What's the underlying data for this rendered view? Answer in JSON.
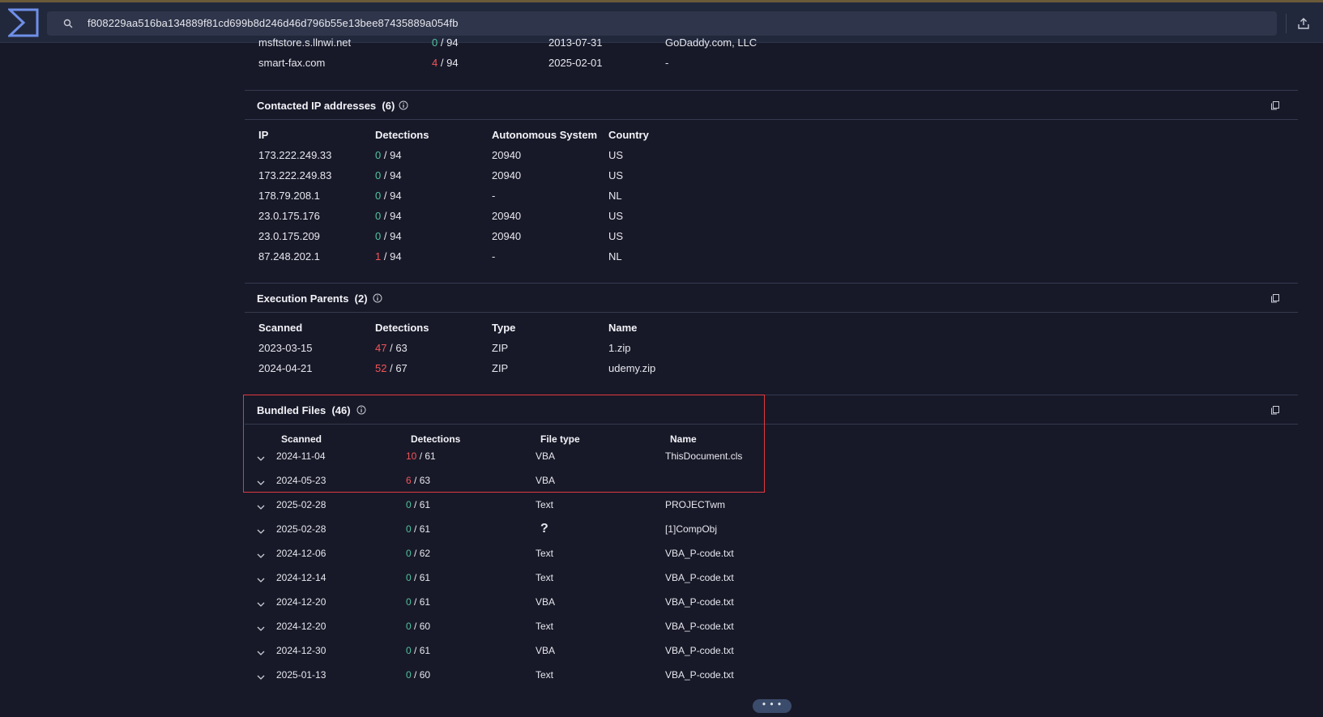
{
  "search": {
    "value": "f808229aa516ba134889f81cd699b8d246d46d796b55e13bee87435889a054fb"
  },
  "domains_partial": {
    "rows": [
      {
        "domain": "msftstore.s.llnwi.net",
        "det": "0",
        "total": "/ 94",
        "date": "2013-07-31",
        "registrar": "GoDaddy.com, LLC"
      },
      {
        "domain": "smart-fax.com",
        "det": "4",
        "total": "/ 94",
        "date": "2025-02-01",
        "registrar": "-"
      }
    ]
  },
  "contacted_ips": {
    "title": "Contacted IP addresses",
    "count": "(6)",
    "headers": [
      "IP",
      "Detections",
      "Autonomous System",
      "Country"
    ],
    "rows": [
      {
        "ip": "173.222.249.33",
        "det": "0",
        "total": "/ 94",
        "as": "20940",
        "country": "US"
      },
      {
        "ip": "173.222.249.83",
        "det": "0",
        "total": "/ 94",
        "as": "20940",
        "country": "US"
      },
      {
        "ip": "178.79.208.1",
        "det": "0",
        "total": "/ 94",
        "as": "-",
        "country": "NL"
      },
      {
        "ip": "23.0.175.176",
        "det": "0",
        "total": "/ 94",
        "as": "20940",
        "country": "US"
      },
      {
        "ip": "23.0.175.209",
        "det": "0",
        "total": "/ 94",
        "as": "20940",
        "country": "US"
      },
      {
        "ip": "87.248.202.1",
        "det": "1",
        "total": "/ 94",
        "as": "-",
        "country": "NL"
      }
    ]
  },
  "execution_parents": {
    "title": "Execution Parents",
    "count": "(2)",
    "headers": [
      "Scanned",
      "Detections",
      "Type",
      "Name"
    ],
    "rows": [
      {
        "scanned": "2023-03-15",
        "det": "47",
        "total": "/ 63",
        "type": "ZIP",
        "name": "1.zip"
      },
      {
        "scanned": "2024-04-21",
        "det": "52",
        "total": "/ 67",
        "type": "ZIP",
        "name": "udemy.zip"
      }
    ]
  },
  "bundled_files": {
    "title": "Bundled Files",
    "count": "(46)",
    "headers": [
      "Scanned",
      "Detections",
      "File type",
      "Name"
    ],
    "rows": [
      {
        "scanned": "2024-11-04",
        "det": "10",
        "total": "/ 61",
        "type": "VBA",
        "name": "ThisDocument.cls"
      },
      {
        "scanned": "2024-05-23",
        "det": "6",
        "total": "/ 63",
        "type": "VBA",
        "name": ""
      },
      {
        "scanned": "2025-02-28",
        "det": "0",
        "total": "/ 61",
        "type": "Text",
        "name": "PROJECTwm"
      },
      {
        "scanned": "2025-02-28",
        "det": "0",
        "total": "/ 61",
        "type": "?",
        "name": "[1]CompObj"
      },
      {
        "scanned": "2024-12-06",
        "det": "0",
        "total": "/ 62",
        "type": "Text",
        "name": "VBA_P-code.txt"
      },
      {
        "scanned": "2024-12-14",
        "det": "0",
        "total": "/ 61",
        "type": "Text",
        "name": "VBA_P-code.txt"
      },
      {
        "scanned": "2024-12-20",
        "det": "0",
        "total": "/ 61",
        "type": "VBA",
        "name": "VBA_P-code.txt"
      },
      {
        "scanned": "2024-12-20",
        "det": "0",
        "total": "/ 60",
        "type": "Text",
        "name": "VBA_P-code.txt"
      },
      {
        "scanned": "2024-12-30",
        "det": "0",
        "total": "/ 61",
        "type": "VBA",
        "name": "VBA_P-code.txt"
      },
      {
        "scanned": "2025-01-13",
        "det": "0",
        "total": "/ 60",
        "type": "Text",
        "name": "VBA_P-code.txt"
      }
    ]
  },
  "more_button": {
    "label": "• • •"
  },
  "colors": {
    "detected": "#f0565a",
    "clean": "#4ec3a0",
    "highlight": "#e0393e",
    "accent": "#6f8fe8"
  }
}
